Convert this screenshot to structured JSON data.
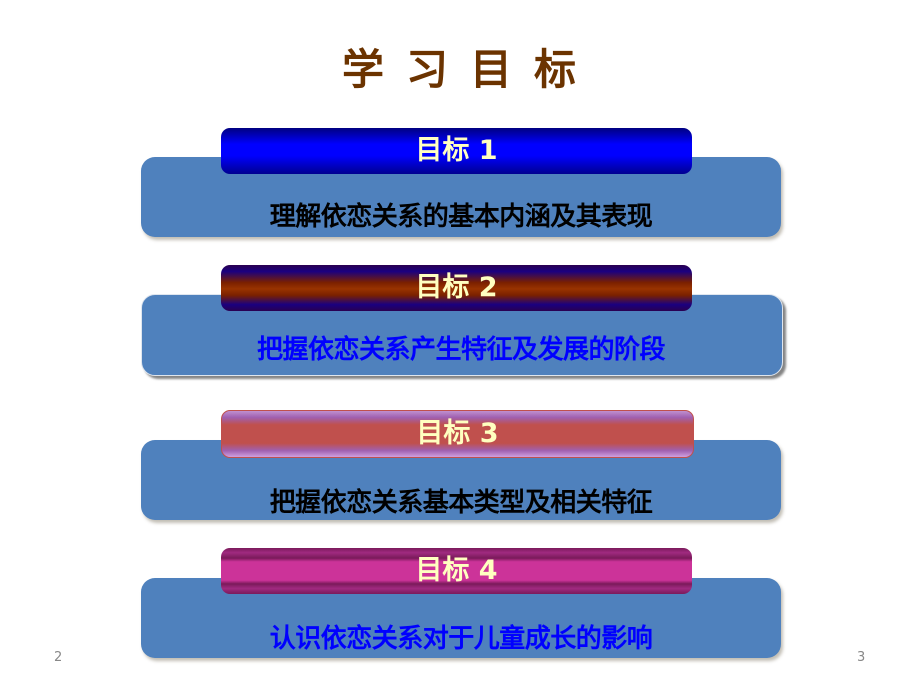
{
  "slide": {
    "title": "学习目标",
    "page_left": "2",
    "page_right": "3"
  },
  "goals": [
    {
      "label": "目标  1",
      "text": "理解依恋关系的基本内涵及其表现",
      "text_color": "#000000"
    },
    {
      "label": "目标 2",
      "text": "把握依恋关系产生特征及发展的阶段",
      "text_color": "#0000ff"
    },
    {
      "label": "目标 3",
      "text": "把握依恋关系基本类型及相关特征",
      "text_color": "#000000"
    },
    {
      "label": "目标 4",
      "text": "认识依恋关系对于儿童成长的影响",
      "text_color": "#0000ff"
    }
  ],
  "colors": {
    "title": "#6b3300",
    "box_body": "#4f81bd",
    "header_text": "#ffffc0"
  }
}
